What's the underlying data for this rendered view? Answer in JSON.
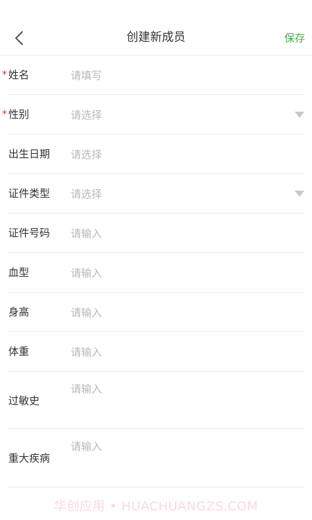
{
  "header": {
    "title": "创建新成员",
    "save_label": "保存"
  },
  "form": {
    "name": {
      "label": "姓名",
      "placeholder": "请填写",
      "required_mark": "*"
    },
    "gender": {
      "label": "性别",
      "placeholder": "请选择",
      "required_mark": "*"
    },
    "birthdate": {
      "label": "出生日期",
      "placeholder": "请选择"
    },
    "id_type": {
      "label": "证件类型",
      "placeholder": "请选择"
    },
    "id_number": {
      "label": "证件号码",
      "placeholder": "请输入"
    },
    "blood_type": {
      "label": "血型",
      "placeholder": "请输入"
    },
    "height": {
      "label": "身高",
      "placeholder": "请输入"
    },
    "weight": {
      "label": "体重",
      "placeholder": "请输入"
    },
    "allergy_history": {
      "label": "过敏史",
      "placeholder": "请输入"
    },
    "major_illness": {
      "label": "重大疾病",
      "placeholder": "请输入"
    }
  },
  "watermark": "华创应用 • HUACHUANGZS.COM",
  "colors": {
    "accent": "#3fae49",
    "required": "#e0302f",
    "placeholder": "#b8b8b8"
  },
  "icons": {
    "back": "chevron-left-icon",
    "dropdown": "triangle-down-icon"
  }
}
